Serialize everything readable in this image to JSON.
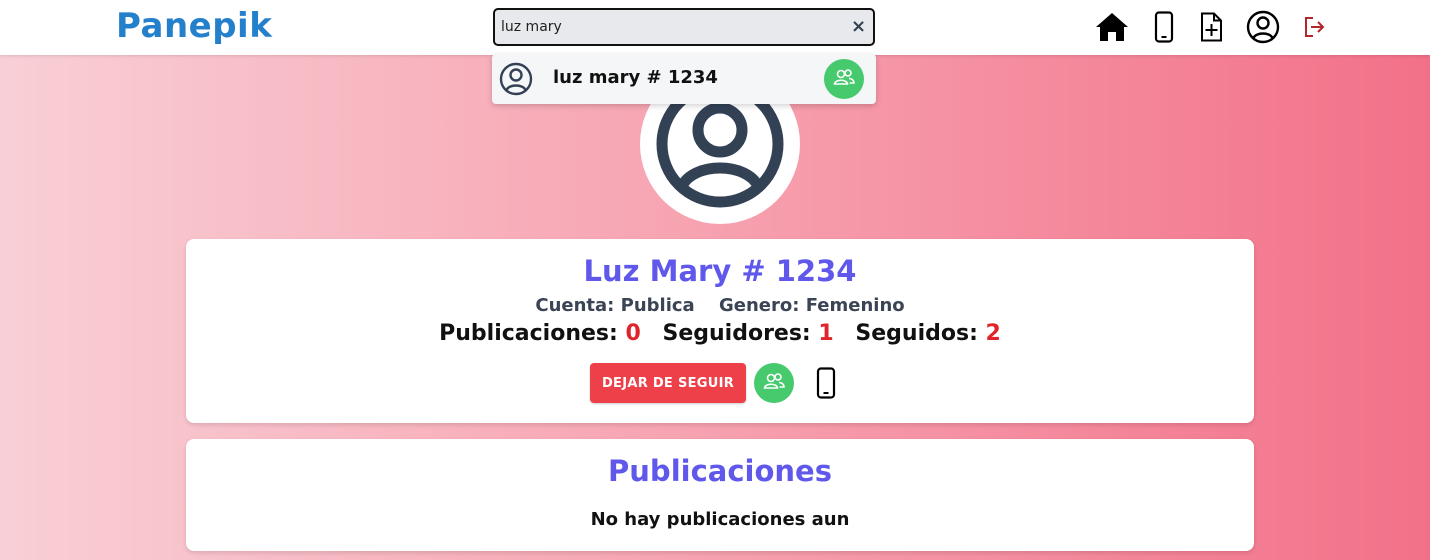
{
  "navbar": {
    "brand": "Panepik",
    "search": {
      "value": "luz mary",
      "placeholder": ""
    },
    "icons": [
      "home-icon",
      "phone-icon",
      "new-file-icon",
      "user-icon",
      "logout-icon"
    ]
  },
  "search_results": [
    {
      "name": "luz mary # 1234",
      "action_icon": "users-icon"
    }
  ],
  "profile": {
    "name": "Luz Mary # 1234",
    "account_label": "Cuenta:",
    "account_value": "Publica",
    "gender_label": "Genero:",
    "gender_value": "Femenino",
    "stats": {
      "publications_label": "Publicaciones:",
      "publications": "0",
      "followers_label": "Seguidores:",
      "followers": "1",
      "following_label": "Seguidos:",
      "following": "2"
    },
    "unfollow_label": "DEJAR DE SEGUIR"
  },
  "posts": {
    "title": "Publicaciones",
    "empty_message": "No hay publicaciones aun"
  },
  "colors": {
    "brand": "#2580cc",
    "accent_title": "#6058ea",
    "danger": "#ee4049",
    "stat_value": "#e0242c",
    "green": "#47c96d",
    "logout": "#b3262d"
  }
}
